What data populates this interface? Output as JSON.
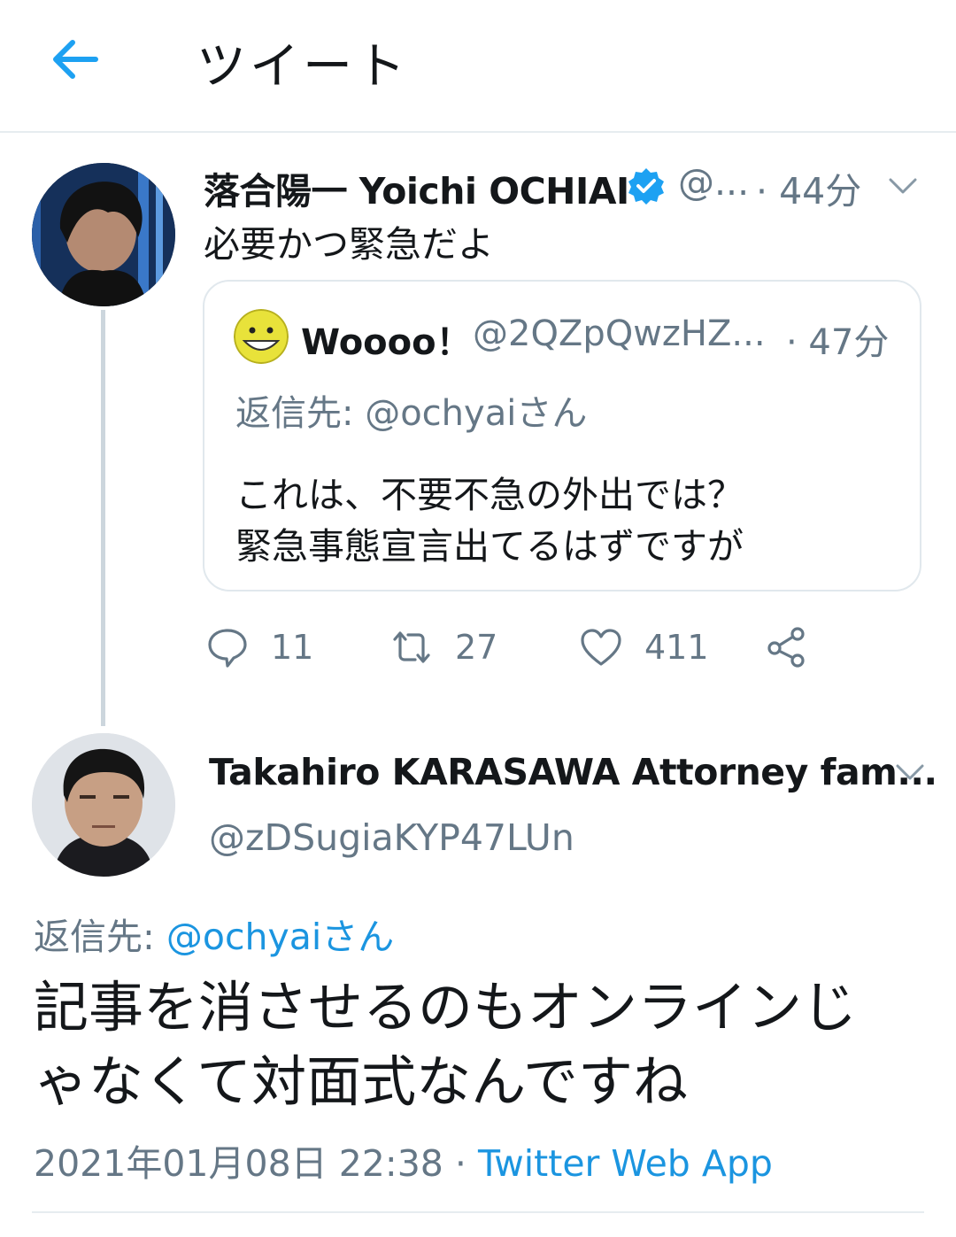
{
  "header": {
    "title": "ツイート",
    "back_icon": "arrow-left-icon",
    "accent_color": "#1da1f2"
  },
  "tweet": {
    "author_name": "落合陽一 Yoichi OCHIAI",
    "verified_icon": "verified-badge-icon",
    "handle": "@...",
    "time": "· 44分",
    "text": "必要かつ緊急だよ",
    "quote": {
      "author_name": "Woooo！",
      "handle": "@2QZpQwzHZ...",
      "time": "· 47分",
      "reply_prefix": "返信先: ",
      "reply_handle": "@ochyaiさん",
      "text_line1": "これは、不要不急の外出では？",
      "text_line2": "緊急事態宣言出てるはずですが"
    },
    "actions": {
      "reply_count": "11",
      "retweet_count": "27",
      "like_count": "411"
    }
  },
  "reply": {
    "author_name": "Takahiro KARASAWA Attorney fam...",
    "handle": "@zDSugiaKYP47LUn",
    "reply_prefix": "返信先: ",
    "reply_handle": "@ochyaiさん",
    "text_line1": "記事を消させるのもオンラインじ",
    "text_line2": "ゃなくて対面式なんですね",
    "timestamp": "2021年01月08日 22:38 · ",
    "source": "Twitter Web App"
  }
}
